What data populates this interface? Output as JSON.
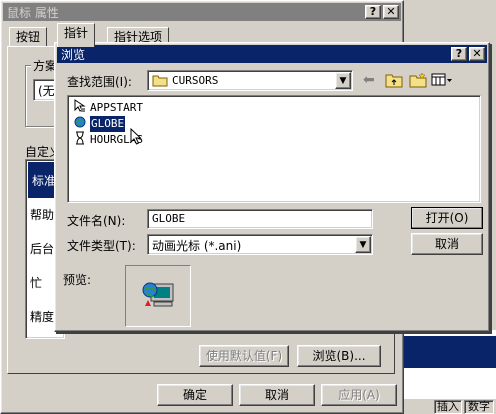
{
  "mouse_window": {
    "title": "鼠标 属性",
    "tabs": [
      "按钮",
      "指针",
      "指针选项"
    ],
    "scheme_group_label": "方案",
    "scheme_value": "(无",
    "custom_label": "自定义",
    "cursor_list": [
      "标准",
      "帮助",
      "后台",
      "忙",
      "精度"
    ],
    "use_default_label": "使用默认值(F)",
    "browse_label": "浏览(B)...",
    "ok_label": "确定",
    "cancel_label": "取消",
    "apply_label": "应用(A)"
  },
  "browse_dialog": {
    "title": "浏览",
    "look_in_label": "查找范围(I):",
    "look_in_value": "CURSORS",
    "files": [
      {
        "name": "APPSTART",
        "icon": "animated-cursor-icon"
      },
      {
        "name": "GLOBE",
        "icon": "globe-cursor-icon",
        "selected": true
      },
      {
        "name": "HOURGLAS",
        "icon": "hourglass-icon"
      }
    ],
    "filename_label": "文件名(N):",
    "filename_value": "GLOBE",
    "filetype_label": "文件类型(T):",
    "filetype_value": "动画光标 (*.ani)",
    "open_label": "打开(O)",
    "cancel_label": "取消",
    "preview_label": "预览:"
  },
  "taskbar": {
    "insert_label": "插入",
    "num_label": "数字"
  },
  "colors": {
    "active_title": "#0a246a",
    "inactive_title": "#808080",
    "face": "#d4d0c8"
  }
}
